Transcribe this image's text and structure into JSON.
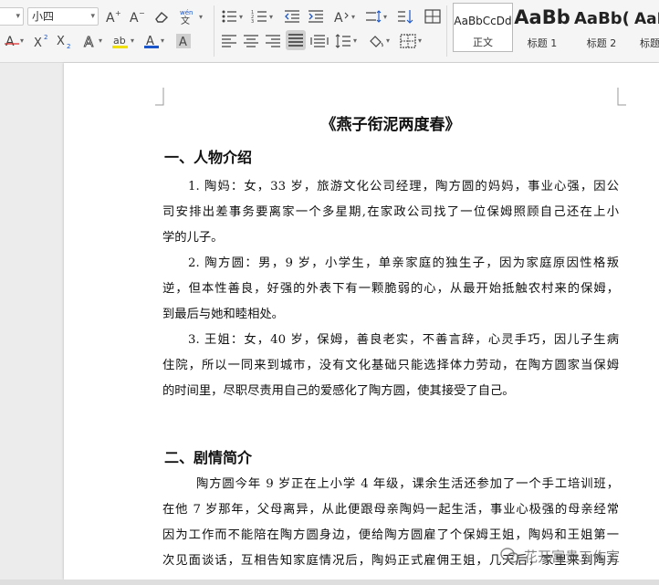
{
  "ribbon": {
    "font_size": "小四",
    "font_name": "",
    "style_gallery": [
      {
        "sample": "AaBbCcDd",
        "name": "正文"
      },
      {
        "sample": "AaBb",
        "name": "标题 1"
      },
      {
        "sample": "AaBb(",
        "name": "标题 2"
      },
      {
        "sample": "AaB",
        "name": "标题"
      }
    ],
    "font_color": "#1a56c9",
    "highlight_color": "#f0e000",
    "underline_color": "#d22"
  },
  "document": {
    "title": "《燕子衔泥两度春》",
    "section1": {
      "heading": "一、人物介绍",
      "lines": [
        "1. 陶妈：女，33 岁，旅游文化公司经理，陶方圆的妈妈，事业心强，因公",
        "司安排出差事务要离家一个多星期,在家政公司找了一位保姆照顾自己还在上小",
        "学的儿子。",
        "2. 陶方圆：男，9 岁，小学生，单亲家庭的独生子，因为家庭原因性格叛",
        "逆，但本性善良，好强的外表下有一颗脆弱的心，从最开始抵触农村来的保姆，",
        "到最后与她和睦相处。",
        "3. 王姐：女，40 岁，保姆，善良老实，不善言辞，心灵手巧，因儿子生病",
        "住院，所以一同来到城市，没有文化基础只能选择体力劳动，在陶方圆家当保姆",
        "的时间里，尽职尽责用自己的爱感化了陶方圆，使其接受了自己。"
      ]
    },
    "section2": {
      "heading": "二、剧情简介",
      "lines": [
        "陶方圆今年 9 岁正在上小学 4 年级，课余生活还参加了一个手工培训班，",
        "在他 7 岁那年，父母离异，从此便跟母亲陶妈一起生活，事业心极强的母亲经常",
        "因为工作而不能陪在陶方圆身边，便给陶方圆雇了个保姆王姐，陶妈和王姐第一",
        "次见面谈话，互相告知家庭情况后，陶妈正式雇佣王姐，几天后，家里来到陶方"
      ]
    }
  },
  "watermark": "花开富贵工作室"
}
